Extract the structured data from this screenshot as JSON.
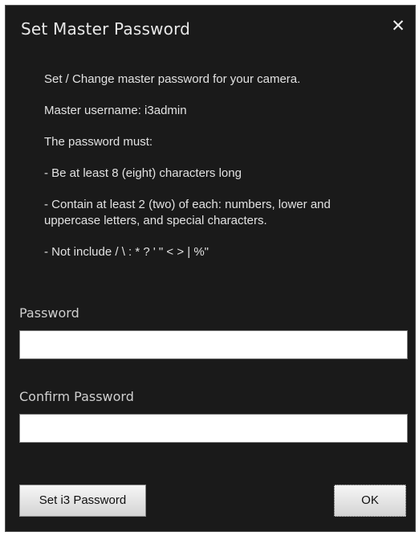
{
  "dialog": {
    "title": "Set Master Password",
    "close_symbol": "✕"
  },
  "info": {
    "lines": [
      "Set / Change master password for your camera.",
      "Master username: i3admin",
      "The password must:",
      "- Be at least 8 (eight) characters long",
      "- Contain at least 2 (two) of each: numbers, lower and uppercase letters, and special characters.",
      "- Not include / \\ : * ? ' \" < > | %\""
    ]
  },
  "fields": {
    "password_label": "Password",
    "password_value": "",
    "confirm_label": "Confirm Password",
    "confirm_value": ""
  },
  "buttons": {
    "set_password": "Set i3 Password",
    "ok": "OK"
  }
}
